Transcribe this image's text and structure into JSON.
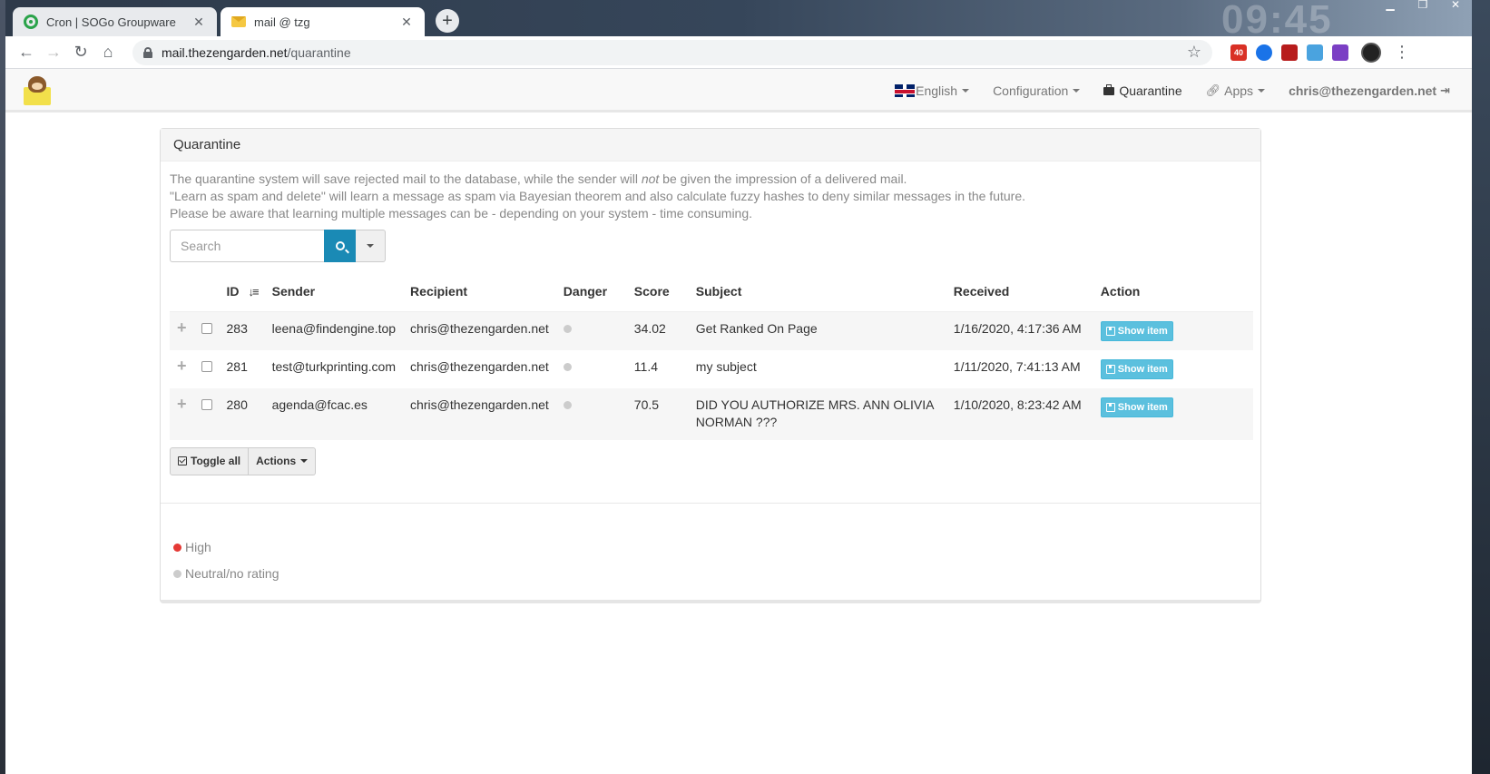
{
  "browser": {
    "tabs": [
      {
        "title": "Cron | SOGo Groupware",
        "icon": "target-icon",
        "active": false
      },
      {
        "title": "mail @ tzg",
        "icon": "envelope-icon",
        "active": true
      }
    ],
    "clock": "09:45",
    "url_host": "mail.thezengarden.net",
    "url_path": "/quarantine",
    "extension_badge": "40"
  },
  "nav": {
    "language": "English",
    "configuration": "Configuration",
    "quarantine": "Quarantine",
    "apps": "Apps",
    "user": "chris@thezengarden.net"
  },
  "panel": {
    "title": "Quarantine",
    "desc_line1_a": "The quarantine system will save rejected mail to the database, while the sender will ",
    "desc_line1_em": "not",
    "desc_line1_b": " be given the impression of a delivered mail.",
    "desc_line2": "\"Learn as spam and delete\" will learn a message as spam via Bayesian theorem and also calculate fuzzy hashes to deny similar messages in the future.",
    "desc_line3": "Please be aware that learning multiple messages can be - depending on your system - time consuming.",
    "search_placeholder": "Search"
  },
  "table": {
    "headers": {
      "id": "ID",
      "sender": "Sender",
      "recipient": "Recipient",
      "danger": "Danger",
      "score": "Score",
      "subject": "Subject",
      "received": "Received",
      "action": "Action"
    },
    "rows": [
      {
        "id": "283",
        "sender": "leena@findengine.top",
        "recipient": "chris@thezengarden.net",
        "score": "34.02",
        "subject": "Get Ranked On Page",
        "received": "1/16/2020, 4:17:36 AM",
        "action": "Show item"
      },
      {
        "id": "281",
        "sender": "test@turkprinting.com",
        "recipient": "chris@thezengarden.net",
        "score": "11.4",
        "subject": "my subject",
        "received": "1/11/2020, 7:41:13 AM",
        "action": "Show item"
      },
      {
        "id": "280",
        "sender": "agenda@fcac.es",
        "recipient": "chris@thezengarden.net",
        "score": "70.5",
        "subject": "DID YOU AUTHORIZE MRS. ANN OLIVIA NORMAN ???",
        "received": "1/10/2020, 8:23:42 AM",
        "action": "Show item"
      }
    ]
  },
  "buttons": {
    "toggle_all": "Toggle all",
    "actions": "Actions"
  },
  "legend": {
    "high": "High",
    "neutral": "Neutral/no rating"
  },
  "colors": {
    "primary": "#1a8ab5",
    "info": "#5bc0de",
    "danger_high": "#e53935",
    "neutral": "#cccccc"
  }
}
